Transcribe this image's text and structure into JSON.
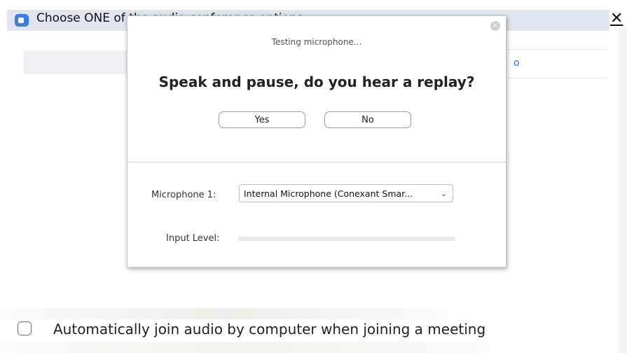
{
  "window": {
    "title": "Choose ONE of the audio conference options",
    "close_glyph": "✕"
  },
  "background": {
    "tab_fragment": "o"
  },
  "modal": {
    "close_glyph": "×",
    "status": "Testing microphone...",
    "question": "Speak and pause, do you hear a replay?",
    "yes_label": "Yes",
    "no_label": "No",
    "microphone_label": "Microphone 1:",
    "microphone_value": "Internal Microphone (Conexant Smar...",
    "input_level_label": "Input Level:",
    "input_level": 0
  },
  "footer": {
    "auto_join_label": "Automatically join audio by computer when joining a meeting",
    "auto_join_checked": false
  },
  "colors": {
    "accent": "#3d7be0",
    "title_strip": "#dfe6ef"
  }
}
